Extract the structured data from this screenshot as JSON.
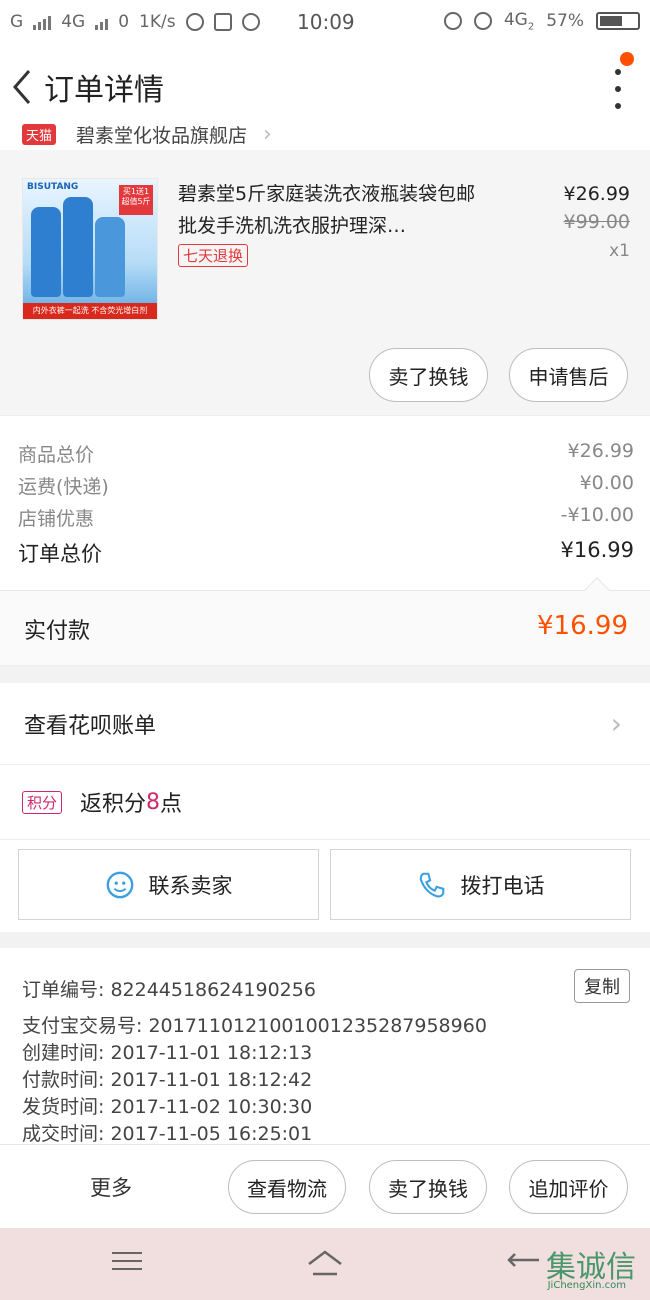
{
  "status_bar": {
    "carrier_left": "G",
    "network_1": "4G",
    "data_speed": "0",
    "speed_unit": "1K/s",
    "time": "10:09",
    "network_2": "4G",
    "network_2_sub": "2",
    "battery": "57%"
  },
  "nav": {
    "title": "订单详情",
    "back_icon": "chevron-left-icon",
    "more_icon": "vertical-dots-icon"
  },
  "shop": {
    "tag": "天猫",
    "name": "碧素堂化妆品旗舰店"
  },
  "product": {
    "image_brand": "BISUTANG",
    "image_promo": "买1送1 超值5斤",
    "image_band": "内外衣裤一起洗 不含荧光增白剂",
    "title": "碧素堂5斤家庭装洗衣液瓶装袋包邮批发手洗机洗衣服护理深…",
    "return_tag": "七天退换",
    "price_now": "¥26.99",
    "price_old": "¥99.00",
    "quantity": "x1",
    "sell_exchange_button": "卖了换钱",
    "after_sale_button": "申请售后"
  },
  "summary": {
    "rows": [
      {
        "label": "商品总价",
        "value": "¥26.99"
      },
      {
        "label": "运费(快递)",
        "value": "¥0.00"
      },
      {
        "label": "店铺优惠",
        "value": "-¥10.00"
      }
    ],
    "total_label": "订单总价",
    "total_value": "¥16.99",
    "paid_label": "实付款",
    "paid_value": "¥16.99"
  },
  "huabei": {
    "label": "查看花呗账单"
  },
  "points": {
    "tag": "积分",
    "text_prefix": "返积分",
    "number": "8",
    "text_suffix": "点"
  },
  "contact": {
    "seller_label": "联系卖家",
    "call_label": "拨打电话"
  },
  "order_info": {
    "order_no": "订单编号: 82244518624190256",
    "copy_label": "复制",
    "alipay_no": "支付宝交易号: 20171101210010012352879589​60",
    "created": "创建时间: 2017-11-01  18:12:13",
    "paid": "付款时间: 2017-11-01  18:12:42",
    "shipped": "发货时间: 2017-11-02  10:30:30",
    "completed": "成交时间: 2017-11-05  16:25:01"
  },
  "actions": {
    "more": "更多",
    "logistics": "查看物流",
    "sell_exchange": "卖了换钱",
    "add_review": "追加评价"
  },
  "watermark": {
    "text": "集诚信",
    "sub": "JiChengXin.com"
  },
  "colors": {
    "accent": "#ff5000",
    "tmall_red": "#e4393c",
    "points_pink": "#d0286a"
  }
}
